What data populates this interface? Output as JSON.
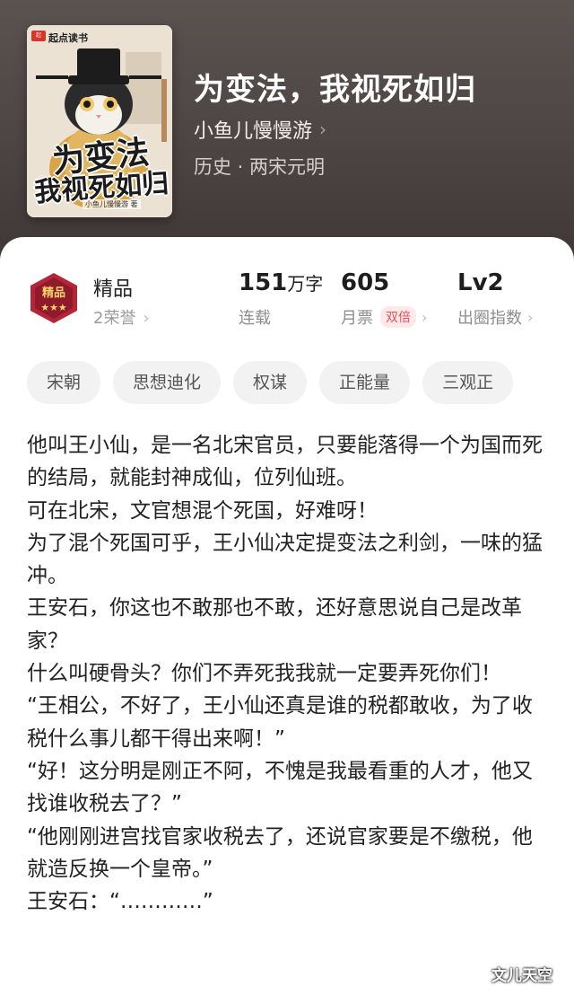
{
  "book": {
    "title": "为变法，我视死如归",
    "author": "小鱼儿慢慢游",
    "author_chevron": "›",
    "genre": "历史 · 两宋元明"
  },
  "cover": {
    "brand": "起点读书",
    "title_line1": "为变法",
    "title_line2": "我视死如归",
    "author": "小鱼儿慢慢游 著"
  },
  "badge": {
    "label": "精品",
    "honors": "2荣誉",
    "chevron": "›"
  },
  "stats": {
    "words": {
      "value": "151",
      "unit": "万字",
      "label": "连载"
    },
    "monthly_ticket": {
      "value": "605",
      "label": "月票",
      "tag": "双倍",
      "chevron": "›"
    },
    "index": {
      "value": "Lv2",
      "label": "出圈指数",
      "chevron": "›"
    }
  },
  "tags": [
    "宋朝",
    "思想迪化",
    "权谋",
    "正能量",
    "三观正"
  ],
  "description": [
    "他叫王小仙，是一名北宋官员，只要能落得一个为国而死的结局，就能封神成仙，位列仙班。",
    "可在北宋，文官想混个死国，好难呀！",
    "为了混个死国可乎，王小仙决定提变法之利剑，一味的猛冲。",
    "王安石，你这也不敢那也不敢，还好意思说自己是改革家？",
    "什么叫硬骨头？你们不弄死我我就一定要弄死你们！",
    "“王相公，不好了，王小仙还真是谁的税都敢收，为了收税什么事儿都干得出来啊！”",
    "“好！这分明是刚正不阿，不愧是我最看重的人才，他又找谁收税去了？”",
    "“他刚刚进宫找官家收税去了，还说官家要是不缴税，他就造反换一个皇帝。”",
    "王安石：“…………”"
  ],
  "watermark": "文儿天空",
  "colors": {
    "header_bg": "#4d4543",
    "accent_red": "#e2525c",
    "tag_bg": "#f2f2f2"
  }
}
